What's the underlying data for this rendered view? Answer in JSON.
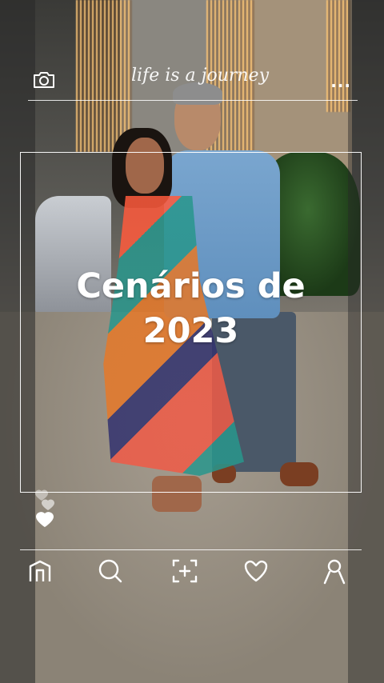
{
  "header": {
    "brand_text": "life is a journey",
    "camera_icon": "camera-icon",
    "more_icon": "more-dots-icon",
    "more_label": "..."
  },
  "post": {
    "title_line1": "Cenários de",
    "title_line2": "2023"
  },
  "reactions": {
    "icon": "heart-icon"
  },
  "bottom_nav": {
    "items": [
      {
        "icon": "home-icon"
      },
      {
        "icon": "search-icon"
      },
      {
        "icon": "add-post-icon"
      },
      {
        "icon": "heart-icon"
      },
      {
        "icon": "profile-icon"
      }
    ]
  },
  "colors": {
    "overlay": "#ffffff",
    "accent": "#ffffff"
  }
}
